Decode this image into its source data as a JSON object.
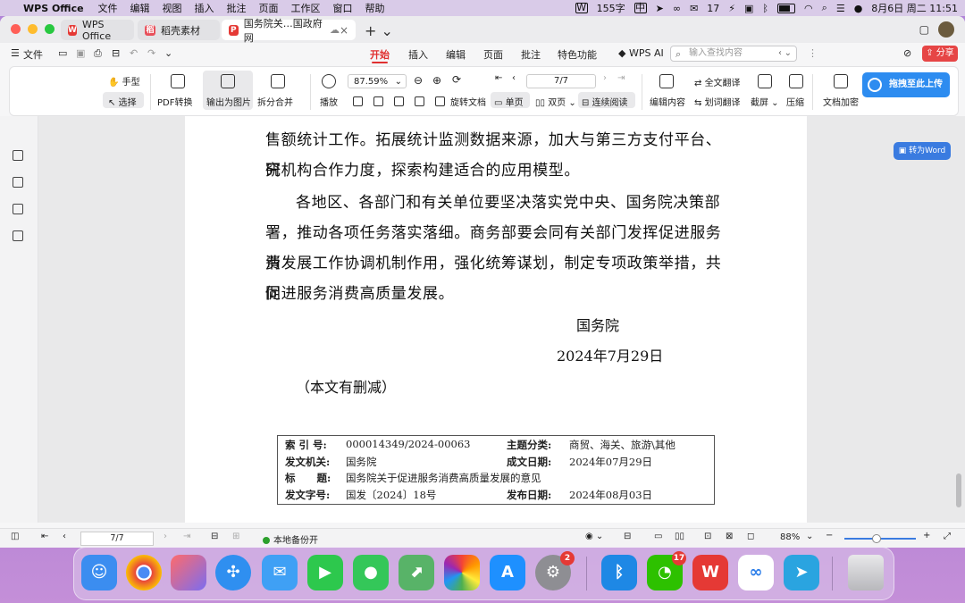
{
  "menubar": {
    "app_name": "WPS Office",
    "items": [
      "文件",
      "编辑",
      "视图",
      "插入",
      "批注",
      "页面",
      "工作区",
      "窗口",
      "帮助"
    ],
    "word_count": "155字",
    "input_method": "中",
    "wechat_count": "17",
    "datetime": "8月6日 周二 11:51"
  },
  "window": {
    "tabs": [
      {
        "label": "WPS Office"
      },
      {
        "label": "稻壳素材"
      },
      {
        "label": "国务院关…国政府网"
      }
    ]
  },
  "ribbon": {
    "file_menu": "文件",
    "tabs": [
      "开始",
      "插入",
      "编辑",
      "页面",
      "批注",
      "特色功能"
    ],
    "active_tab": "开始",
    "wps_ai": "WPS AI",
    "search_placeholder": "输入查找内容",
    "share": "分享"
  },
  "toolbar": {
    "hand": "手型",
    "select": "选择",
    "pdf_convert": "PDF转换",
    "export_image": "输出为图片",
    "split_merge": "拆分合并",
    "play": "播放",
    "zoom": "87.59%",
    "page_indicator": "7/7",
    "rotate": "旋转文档",
    "single_page": "单页",
    "double_page": "双页",
    "continuous": "连续阅读",
    "edit_content": "编辑内容",
    "full_translate": "全文翻译",
    "word_translate": "划词翻译",
    "screenshot": "截屏",
    "compress": "压缩",
    "encrypt": "文档加密",
    "upload": "拖拽至此上传",
    "to_word": "转为Word"
  },
  "document": {
    "paragraphs": [
      "售额统计工作。拓展统计监测数据来源，加大与第三方支付平台、研",
      "究机构合作力度，探索构建适合的应用模型。",
      "各地区、各部门和有关单位要坚决落实党中央、国务院决策部",
      "署，推动各项任务落实落细。商务部要会同有关部门发挥促进服务消",
      "费发展工作协调机制作用，强化统筹谋划，制定专项政策举措，共同",
      "促进服务消费高质量发展。"
    ],
    "signature": "国务院",
    "date": "2024年7月29日",
    "note": "（本文有删减）",
    "metadata": {
      "index_label": "索 引 号:",
      "index_value": "000014349/2024-00063",
      "category_label": "主题分类:",
      "category_value": "商贸、海关、旅游\\其他",
      "issuer_label": "发文机关:",
      "issuer_value": "国务院",
      "written_label": "成文日期:",
      "written_value": "2024年07月29日",
      "title_label": "标      题:",
      "title_value": "国务院关于促进服务消费高质量发展的意见",
      "docno_label": "发文字号:",
      "docno_value": "国发〔2024〕18号",
      "publish_label": "发布日期:",
      "publish_value": "2024年08月03日"
    }
  },
  "statusbar": {
    "page": "7/7",
    "backup": "本地备份开",
    "zoom": "88%"
  },
  "dock": {
    "badges": {
      "settings": "2",
      "wechat": "17"
    }
  }
}
